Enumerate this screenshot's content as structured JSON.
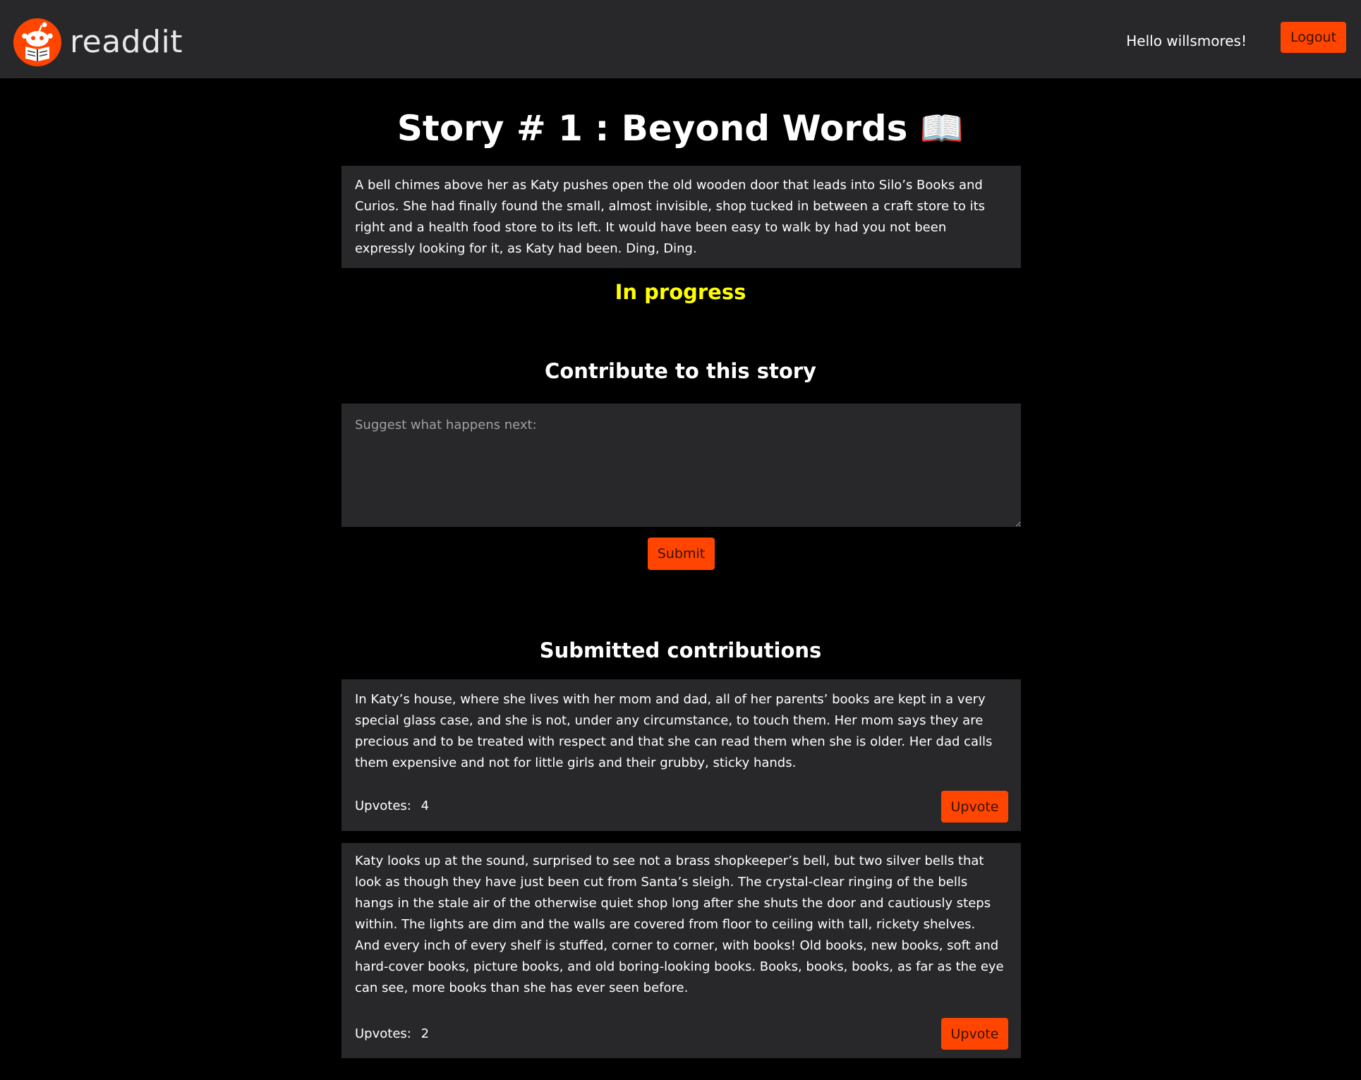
{
  "header": {
    "brand_name": "readdit",
    "logo_icon": "reading-robot-logo-icon",
    "greeting": "Hello willsmores!",
    "logout_label": "Logout",
    "accent_color": "#ff4500"
  },
  "story": {
    "title": "Story # 1 : Beyond Words 📖",
    "body": "A bell chimes above her as Katy pushes open the old wooden door that leads into Silo’s Books and Curios. She had finally found the small, almost invisible, shop tucked in between a craft store to its right and a health food store to its left. It would have been easy to walk by had you not been expressly looking for it, as Katy had been. Ding, Ding.",
    "status": "In progress",
    "status_color": "#ffff00"
  },
  "contribute": {
    "heading": "Contribute to this story",
    "placeholder": "Suggest what happens next:",
    "value": "",
    "submit_label": "Submit"
  },
  "submitted": {
    "heading": "Submitted contributions",
    "upvotes_label": "Upvotes:",
    "upvote_button_label": "Upvote",
    "items": [
      {
        "text": "In Katy’s house, where she lives with her mom and dad, all of her parents’ books are kept in a very special glass case, and she is not, under any circumstance, to touch them. Her mom says they are precious and to be treated with respect and that she can read them when she is older. Her dad calls them expensive and not for little girls and their grubby, sticky hands.",
        "upvotes": "4"
      },
      {
        "text": "Katy looks up at the sound, surprised to see not a brass shopkeeper’s bell, but two silver bells that look as though they have just been cut from Santa’s sleigh. The crystal-clear ringing of the bells hangs in the stale air of the otherwise quiet shop long after she shuts the door and cautiously steps within. The lights are dim and the walls are covered from floor to ceiling with tall, rickety shelves. And every inch of every shelf is stuffed, corner to corner, with books! Old books, new books, soft and hard-cover books, picture books, and old boring-looking books. Books, books, books, as far as the eye can see, more books than she has ever seen before.",
        "upvotes": "2"
      }
    ]
  }
}
